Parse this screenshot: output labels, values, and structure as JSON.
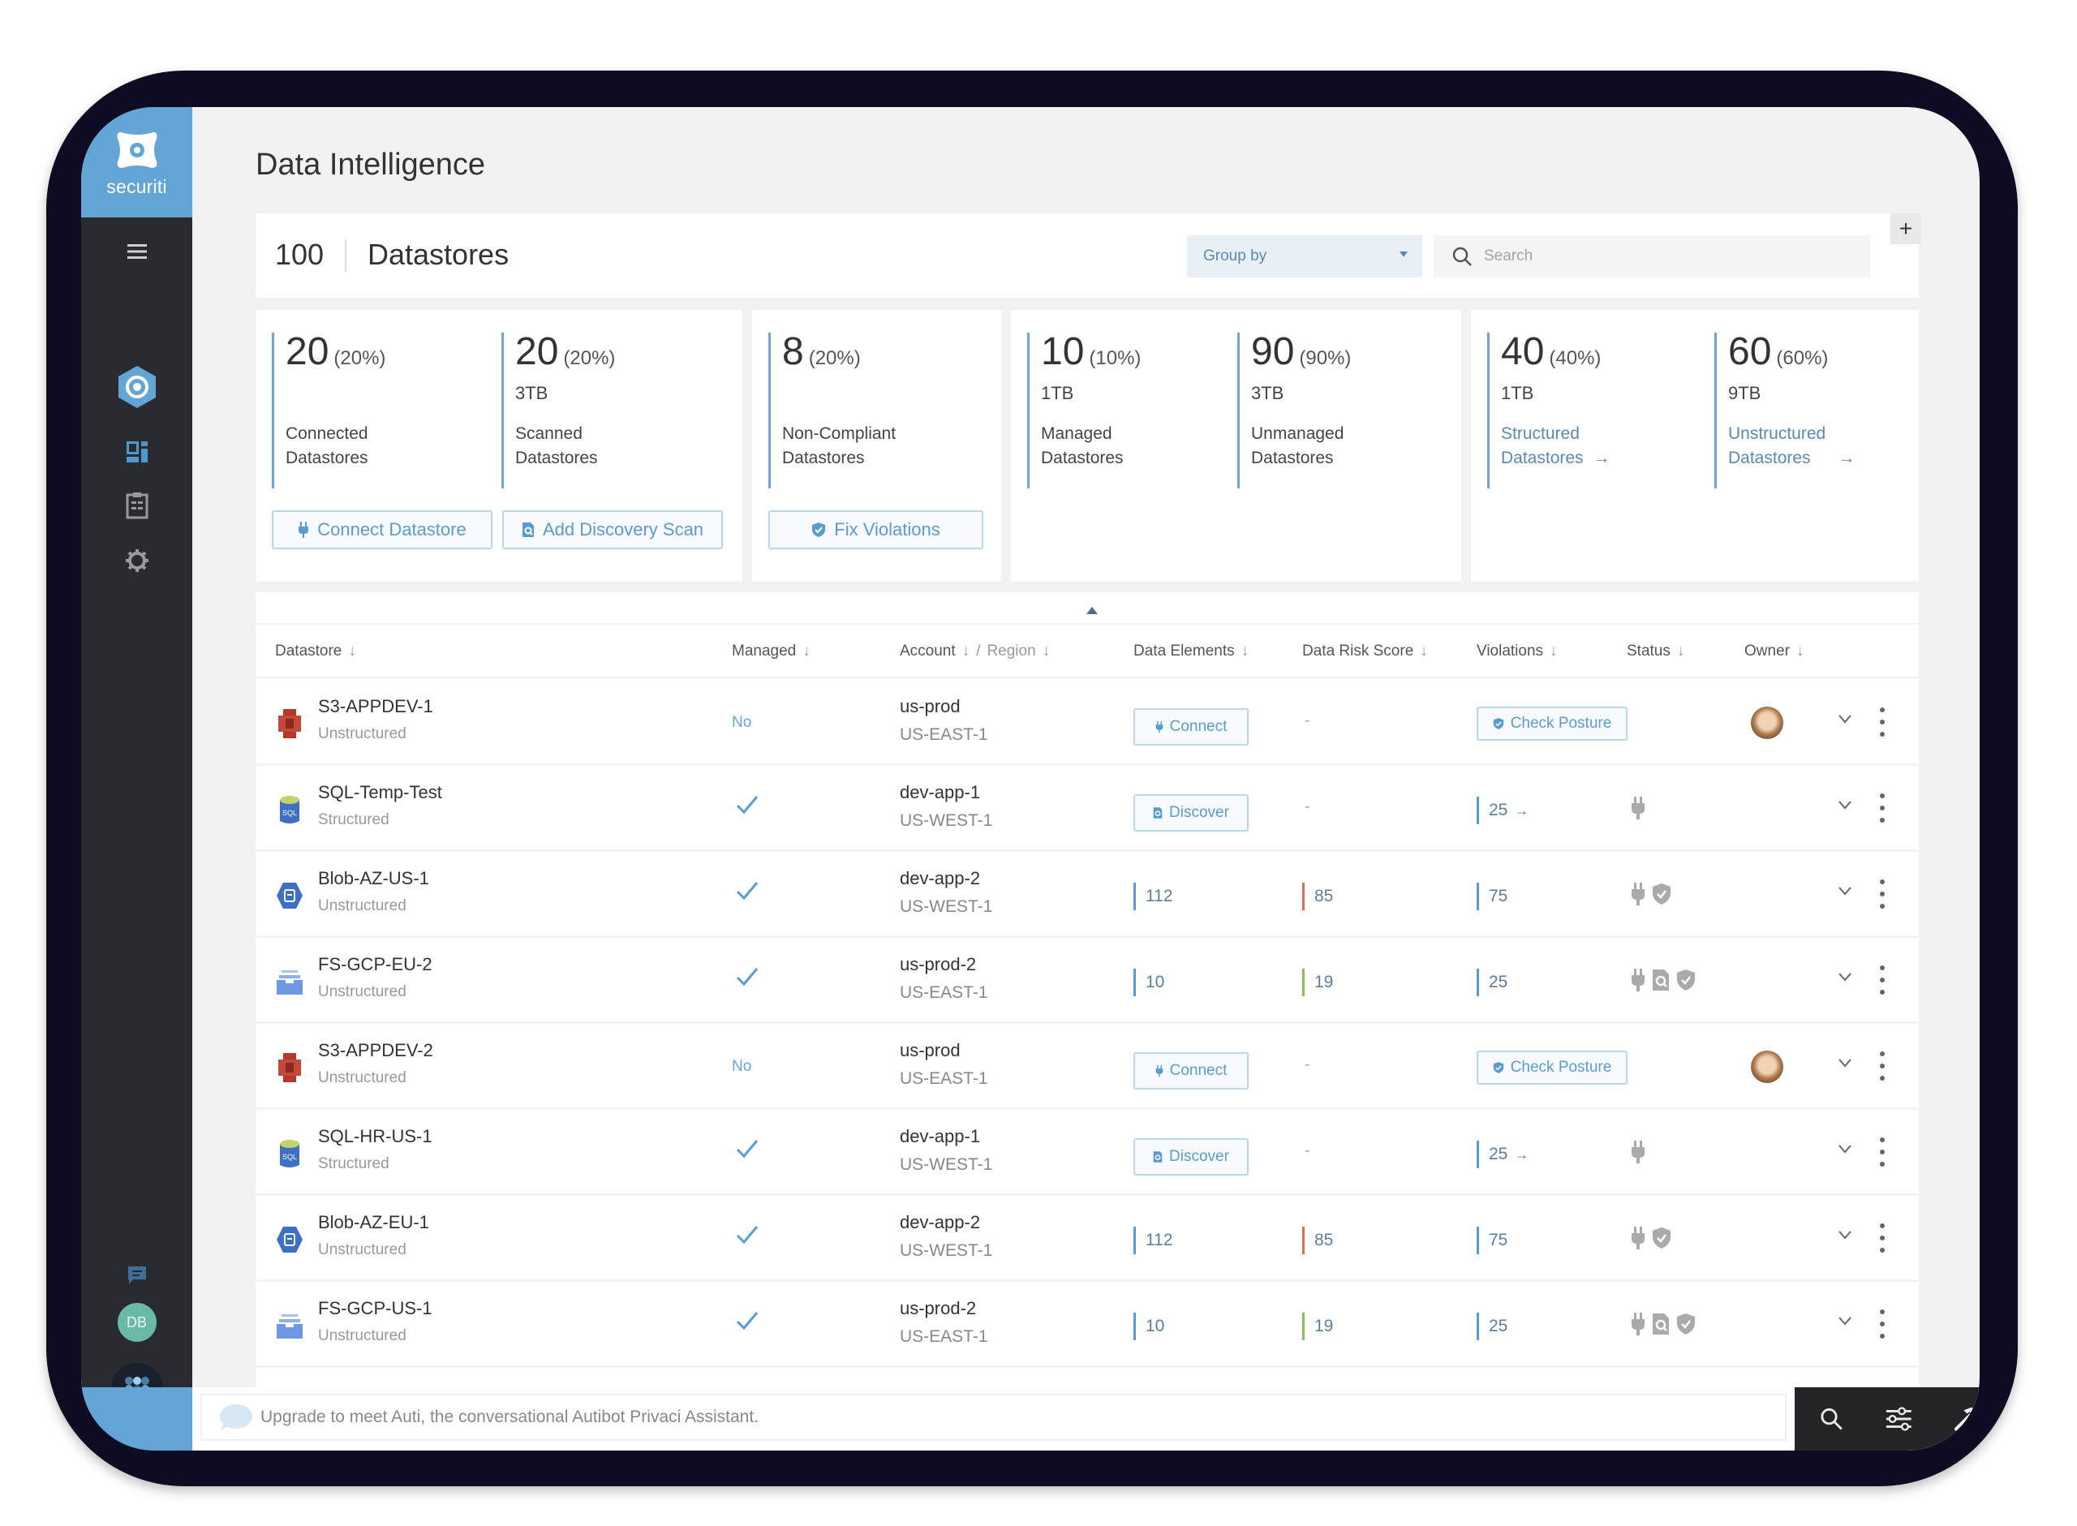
{
  "brand": {
    "name": "securiti",
    "accent": "#62a5d6"
  },
  "page": {
    "title": "Data Intelligence"
  },
  "datastores_header": {
    "count": "100",
    "label": "Datastores",
    "group_by": {
      "label": "Group by"
    },
    "search": {
      "placeholder": "Search"
    },
    "add_label": "+"
  },
  "cards": [
    {
      "stats": [
        {
          "value": "20",
          "percent": "(20%)",
          "size": "",
          "label_line1": "Connected",
          "label_line2": "Datastores"
        },
        {
          "value": "20",
          "percent": "(20%)",
          "size": "3TB",
          "label_line1": "Scanned",
          "label_line2": "Datastores"
        }
      ],
      "buttons": [
        {
          "label": "Connect Datastore",
          "icon": "plug-icon"
        },
        {
          "label": "Add Discovery Scan",
          "icon": "scan-icon"
        }
      ]
    },
    {
      "stats": [
        {
          "value": "8",
          "percent": "(20%)",
          "size": "",
          "label_line1": "Non-Compliant",
          "label_line2": "Datastores"
        }
      ],
      "buttons": [
        {
          "label": "Fix Violations",
          "icon": "shield-check-icon"
        }
      ]
    },
    {
      "stats": [
        {
          "value": "10",
          "percent": "(10%)",
          "size": "1TB",
          "label_line1": "Managed",
          "label_line2": "Datastores"
        },
        {
          "value": "90",
          "percent": "(90%)",
          "size": "3TB",
          "label_line1": "Unmanaged",
          "label_line2": "Datastores"
        }
      ]
    },
    {
      "stats": [
        {
          "value": "40",
          "percent": "(40%)",
          "size": "1TB",
          "label_line1": "Structured",
          "label_line2": "Datastores",
          "arrow": "→"
        },
        {
          "value": "60",
          "percent": "(60%)",
          "size": "9TB",
          "label_line1": "Unstructured",
          "label_line2": "Datastores",
          "arrow": "→"
        }
      ]
    }
  ],
  "table": {
    "columns": {
      "datastore": "Datastore",
      "managed": "Managed",
      "account": "Account",
      "slash": "/",
      "region": "Region",
      "data_elements": "Data Elements",
      "data_risk_score": "Data Risk Score",
      "violations": "Violations",
      "status": "Status",
      "owner": "Owner",
      "sort_glyph": "↓"
    },
    "rows": [
      {
        "name": "S3-APPDEV-1",
        "type": "Unstructured",
        "icon": "aws-s3-icon",
        "managed": "No",
        "account": "us-prod",
        "region": "US-EAST-1",
        "data_elements": {
          "button": "Connect"
        },
        "risk": "-",
        "violations": {
          "button": "Check Posture"
        },
        "status": [],
        "owner": "avatar"
      },
      {
        "name": "SQL-Temp-Test",
        "type": "Structured",
        "icon": "azure-sql-icon",
        "managed": "check",
        "account": "dev-app-1",
        "region": "US-WEST-1",
        "data_elements": {
          "button": "Discover"
        },
        "risk": "-",
        "violations": {
          "value": "25",
          "arrow": "→"
        },
        "status": [
          "plug"
        ],
        "owner": ""
      },
      {
        "name": "Blob-AZ-US-1",
        "type": "Unstructured",
        "icon": "azure-blob-icon",
        "managed": "check",
        "account": "dev-app-2",
        "region": "US-WEST-1",
        "data_elements": {
          "value": "112"
        },
        "risk": {
          "value": "85",
          "level": "high"
        },
        "violations": {
          "value": "75"
        },
        "status": [
          "plug",
          "shield"
        ],
        "owner": ""
      },
      {
        "name": "FS-GCP-EU-2",
        "type": "Unstructured",
        "icon": "gcp-filestore-icon",
        "managed": "check",
        "account": "us-prod-2",
        "region": "US-EAST-1",
        "data_elements": {
          "value": "10"
        },
        "risk": {
          "value": "19",
          "level": "low"
        },
        "violations": {
          "value": "25"
        },
        "status": [
          "plug",
          "scan",
          "shield"
        ],
        "owner": ""
      },
      {
        "name": "S3-APPDEV-2",
        "type": "Unstructured",
        "icon": "aws-s3-icon",
        "managed": "No",
        "account": "us-prod",
        "region": "US-EAST-1",
        "data_elements": {
          "button": "Connect"
        },
        "risk": "-",
        "violations": {
          "button": "Check Posture"
        },
        "status": [],
        "owner": "avatar"
      },
      {
        "name": "SQL-HR-US-1",
        "type": "Structured",
        "icon": "azure-sql-icon",
        "managed": "check",
        "account": "dev-app-1",
        "region": "US-WEST-1",
        "data_elements": {
          "button": "Discover"
        },
        "risk": "-",
        "violations": {
          "value": "25",
          "arrow": "→"
        },
        "status": [
          "plug"
        ],
        "owner": ""
      },
      {
        "name": "Blob-AZ-EU-1",
        "type": "Unstructured",
        "icon": "azure-blob-icon",
        "managed": "check",
        "account": "dev-app-2",
        "region": "US-WEST-1",
        "data_elements": {
          "value": "112"
        },
        "risk": {
          "value": "85",
          "level": "high"
        },
        "violations": {
          "value": "75"
        },
        "status": [
          "plug",
          "shield"
        ],
        "owner": ""
      },
      {
        "name": "FS-GCP-US-1",
        "type": "Unstructured",
        "icon": "gcp-filestore-icon",
        "managed": "check",
        "account": "us-prod-2",
        "region": "US-EAST-1",
        "data_elements": {
          "value": "10"
        },
        "risk": {
          "value": "19",
          "level": "low"
        },
        "violations": {
          "value": "25"
        },
        "status": [
          "plug",
          "scan",
          "shield"
        ],
        "owner": ""
      }
    ]
  },
  "sidebar": {
    "user_initials": "DB",
    "items": [
      "menu-icon",
      "data-intelligence-icon",
      "dashboard-icon",
      "checklist-icon",
      "settings-icon",
      "chat-icon",
      "apps-icon"
    ]
  },
  "assistant": {
    "message": "Upgrade to meet Auti, the conversational Autibot Privaci Assistant."
  },
  "colors": {
    "risk_high": "#d86c5c",
    "risk_low": "#8ebc5a",
    "metric": "#5b9bd0"
  }
}
